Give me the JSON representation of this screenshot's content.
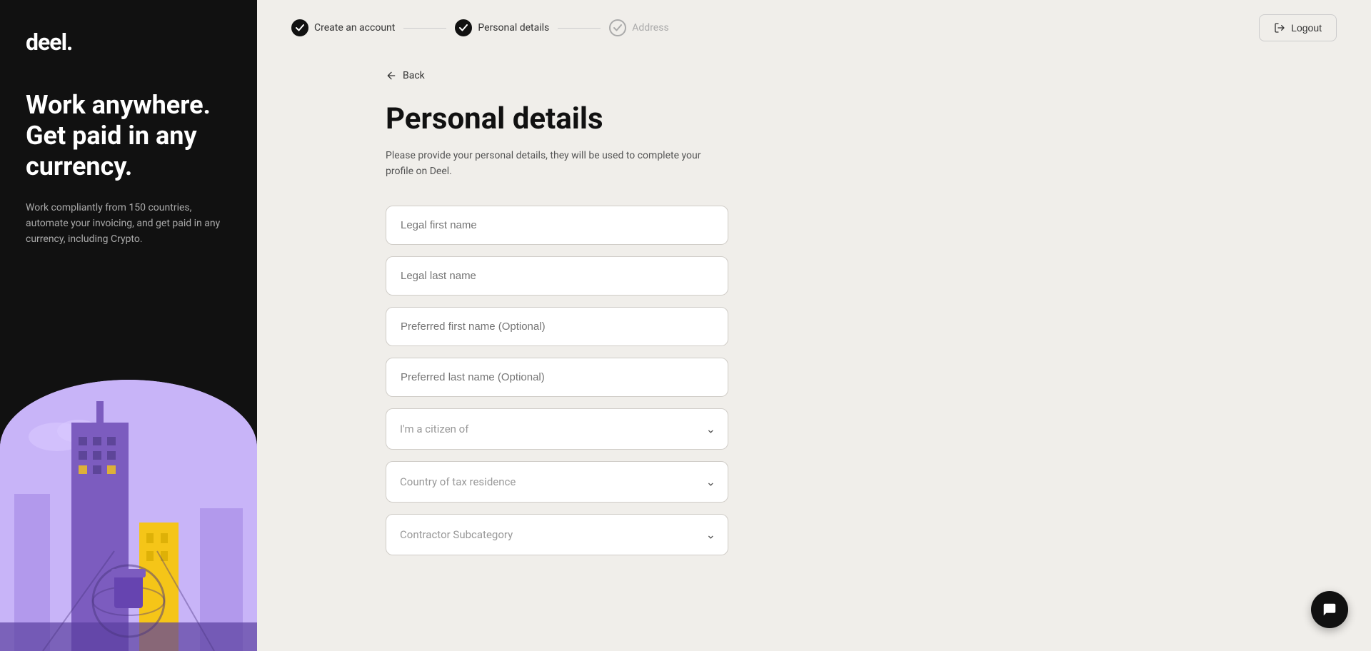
{
  "sidebar": {
    "logo": "deel.",
    "headline": "Work anywhere. Get paid in any currency.",
    "subtext": "Work compliantly from 150 countries, automate your invoicing, and get paid in any currency, including Crypto."
  },
  "topNav": {
    "steps": [
      {
        "id": "create-account",
        "label": "Create an account",
        "state": "completed"
      },
      {
        "id": "personal-details",
        "label": "Personal details",
        "state": "active"
      },
      {
        "id": "address",
        "label": "Address",
        "state": "inactive"
      }
    ],
    "logout_label": "Logout"
  },
  "backLink": "Back",
  "form": {
    "title": "Personal details",
    "description": "Please provide your personal details, they will be used to complete your profile on Deel.",
    "fields": [
      {
        "id": "legal-first-name",
        "type": "text",
        "placeholder": "Legal first name",
        "value": ""
      },
      {
        "id": "legal-last-name",
        "type": "text",
        "placeholder": "Legal last name",
        "value": ""
      },
      {
        "id": "preferred-first-name",
        "type": "text",
        "placeholder": "Preferred first name (Optional)",
        "value": ""
      },
      {
        "id": "preferred-last-name",
        "type": "text",
        "placeholder": "Preferred last name (Optional)",
        "value": ""
      },
      {
        "id": "citizen-of",
        "type": "select",
        "placeholder": "I'm a citizen of",
        "value": ""
      },
      {
        "id": "tax-residence",
        "type": "select",
        "placeholder": "Country of tax residence",
        "value": ""
      },
      {
        "id": "contractor-subcategory",
        "type": "select",
        "placeholder": "Contractor Subcategory",
        "value": ""
      }
    ]
  },
  "chat": {
    "icon": "💬"
  }
}
